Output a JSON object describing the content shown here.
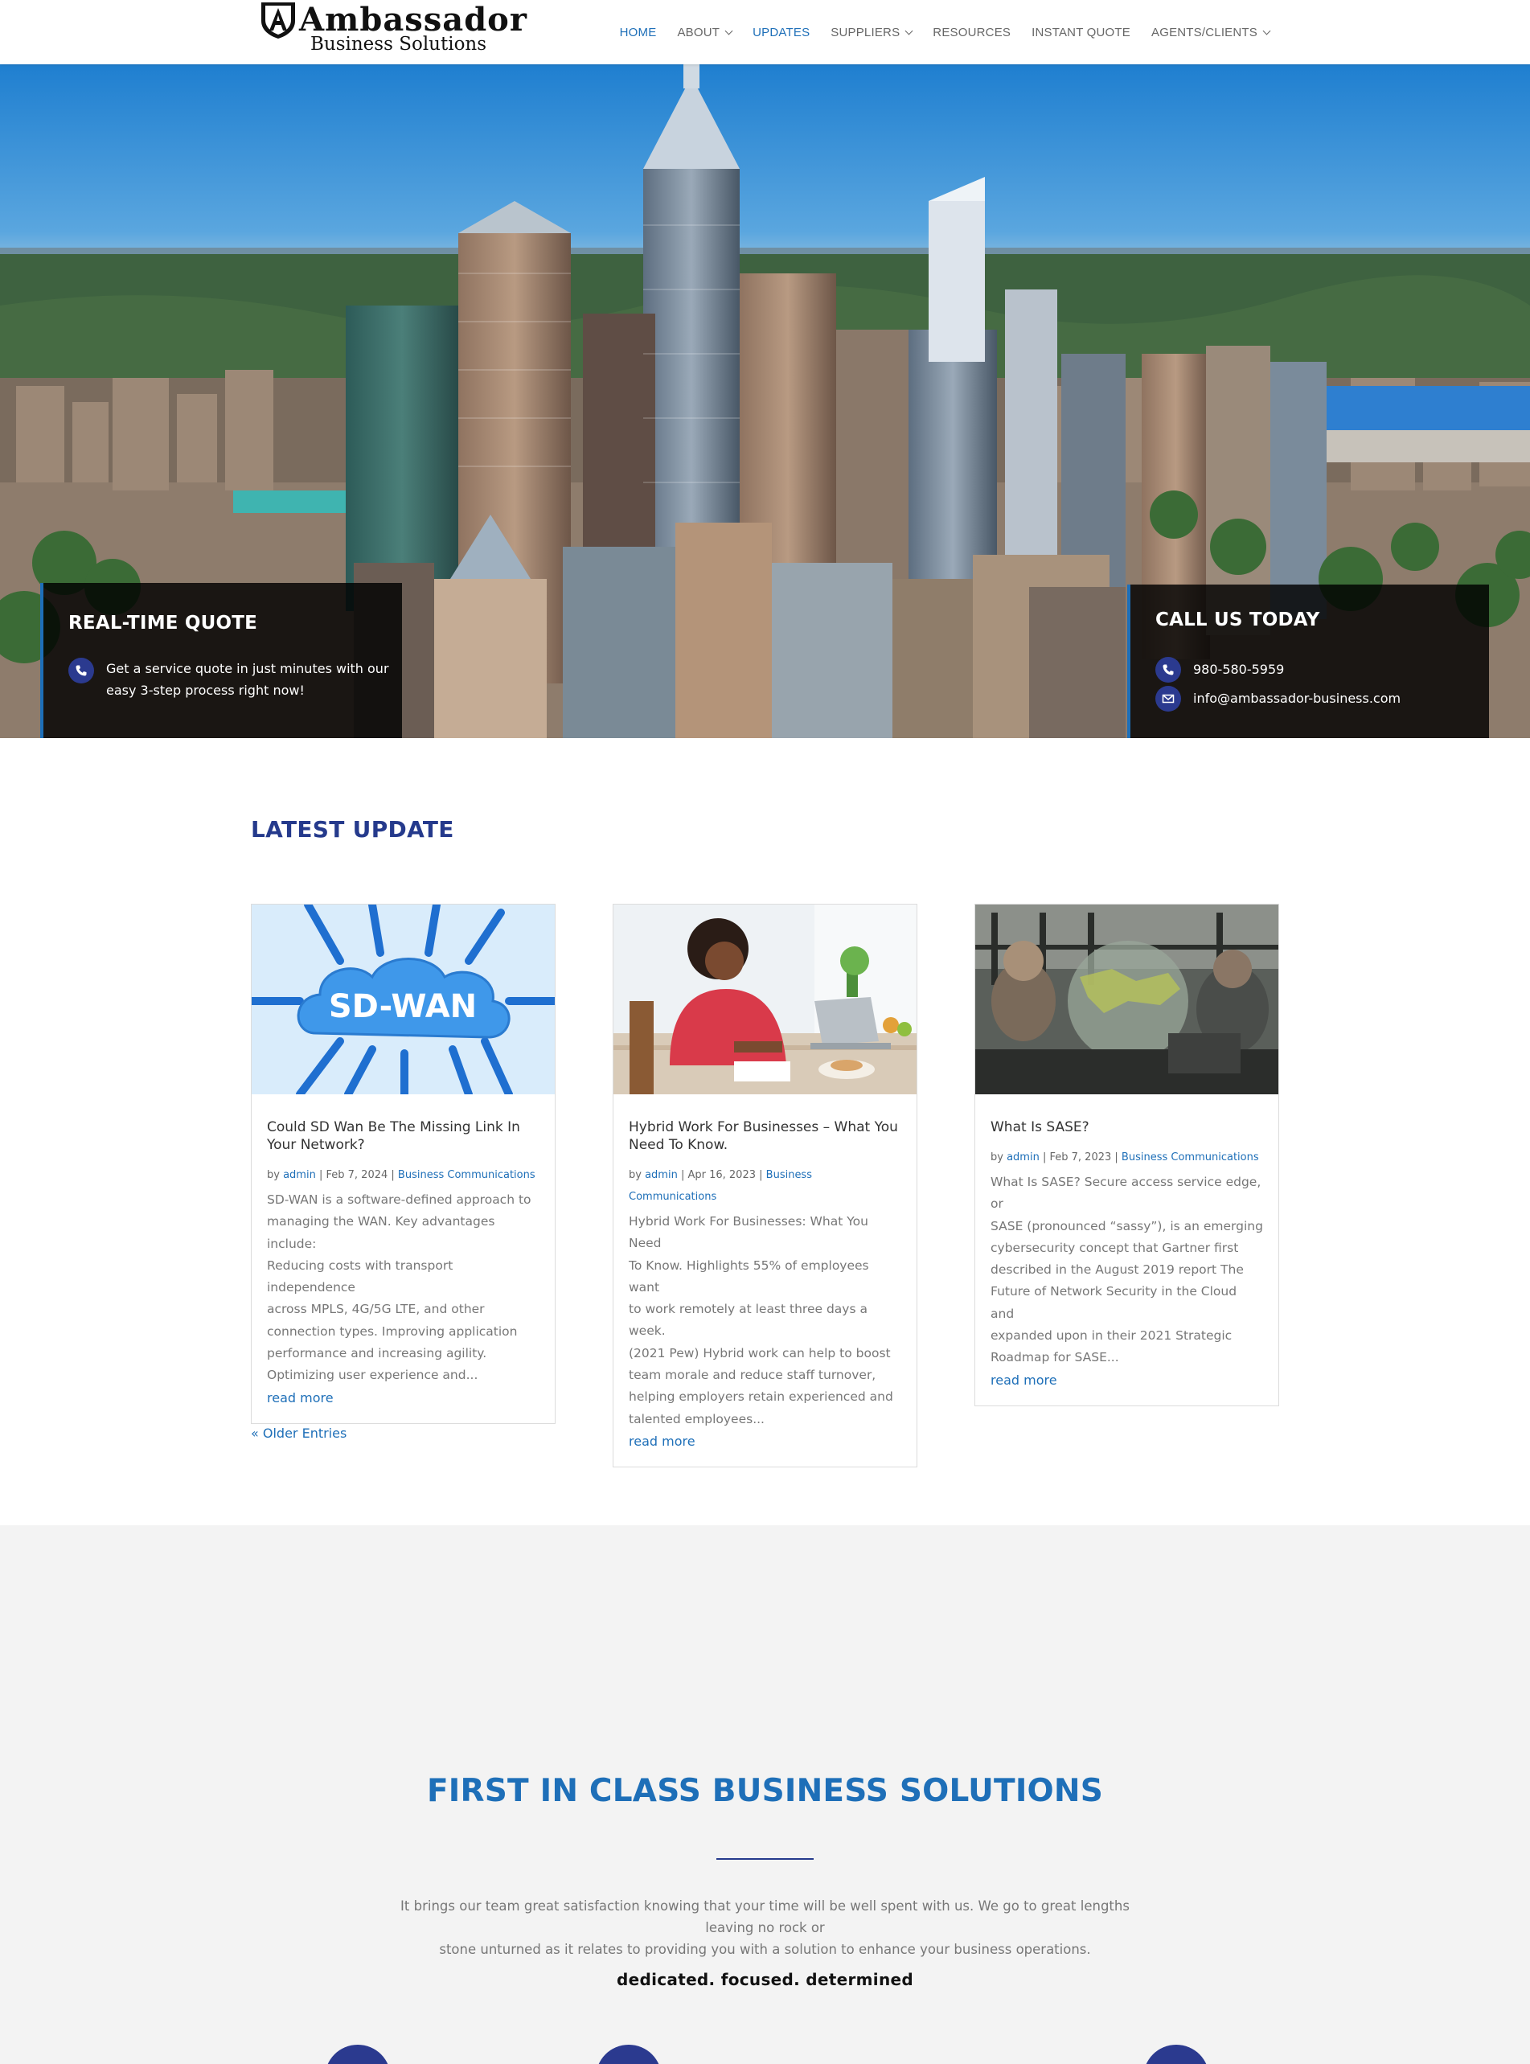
{
  "brand": {
    "name": "Ambassador",
    "tagline": "Business Solutions"
  },
  "nav": {
    "items": [
      {
        "label": "HOME",
        "active": true,
        "has_dropdown": false
      },
      {
        "label": "ABOUT",
        "active": false,
        "has_dropdown": true
      },
      {
        "label": "UPDATES",
        "active": true,
        "has_dropdown": false
      },
      {
        "label": "SUPPLIERS",
        "active": false,
        "has_dropdown": true
      },
      {
        "label": "RESOURCES",
        "active": false,
        "has_dropdown": false
      },
      {
        "label": "INSTANT QUOTE",
        "active": false,
        "has_dropdown": false
      },
      {
        "label": "AGENTS/CLIENTS",
        "active": false,
        "has_dropdown": true
      }
    ]
  },
  "hero": {
    "quote_box": {
      "title": "REAL-TIME QUOTE",
      "icon": "phone-icon",
      "text_line1": "Get a service quote in just minutes with our",
      "text_line2": "easy 3-step process right now!"
    },
    "call_box": {
      "title": "CALL US TODAY",
      "phone_icon": "phone-icon",
      "phone": "980-580-5959",
      "email_icon": "envelope-icon",
      "email": "info@ambassador-business.com"
    }
  },
  "latest": {
    "title": "LATEST UPDATE",
    "posts": [
      {
        "image_label": "SD-WAN",
        "title_line1": "Could SD Wan Be The Missing Link In",
        "title_line2": "Your Network?",
        "by": "by",
        "author": "admin",
        "date": "Feb 7, 2024",
        "category": "Business Communications",
        "excerpt_lines": [
          "SD-WAN is a software-defined approach to",
          "managing the WAN. Key advantages include:",
          "Reducing costs with transport independence",
          "across MPLS, 4G/5G LTE, and other",
          "connection types. Improving application",
          "performance and increasing agility.",
          "Optimizing user experience and..."
        ],
        "read_more": "read more"
      },
      {
        "title_line1": "Hybrid Work For Businesses – What You",
        "title_line2": "Need To Know.",
        "by": "by",
        "author": "admin",
        "date": "Apr 16, 2023",
        "category_line1": "Business",
        "category_line2": "Communications",
        "excerpt_lines": [
          "Hybrid Work For Businesses: What You Need",
          "To Know. Highlights 55% of employees want",
          "to work remotely at least three days a week.",
          "(2021 Pew) Hybrid work can help to boost",
          "team morale and reduce staff turnover,",
          "helping employers retain experienced and",
          "talented employees..."
        ],
        "read_more": "read more"
      },
      {
        "title_line1": "What Is SASE?",
        "by": "by",
        "author": "admin",
        "date": "Feb 7, 2023",
        "category": "Business Communications",
        "excerpt_lines": [
          "What Is SASE? Secure access service edge, or",
          "SASE (pronounced “sassy”), is an emerging",
          "cybersecurity concept that Gartner first",
          "described in the August 2019 report The",
          "Future of Network Security in the Cloud and",
          "expanded upon in their 2021 Strategic",
          "Roadmap for SASE..."
        ],
        "read_more": "read more"
      }
    ],
    "older_entries": "« Older Entries"
  },
  "first_in_class": {
    "title": "FIRST IN CLASS BUSINESS SOLUTIONS",
    "text_line1": "It brings our team great satisfaction knowing that your time will be well spent with us. We go to great lengths leaving no rock or",
    "text_line2": "stone unturned as it relates to providing you with a solution to enhance your business operations.",
    "tagline": "dedicated. focused. determined"
  },
  "colors": {
    "brand_blue": "#1e6fb8",
    "navy": "#253a8c",
    "icon_navy": "#2b3a8f"
  }
}
